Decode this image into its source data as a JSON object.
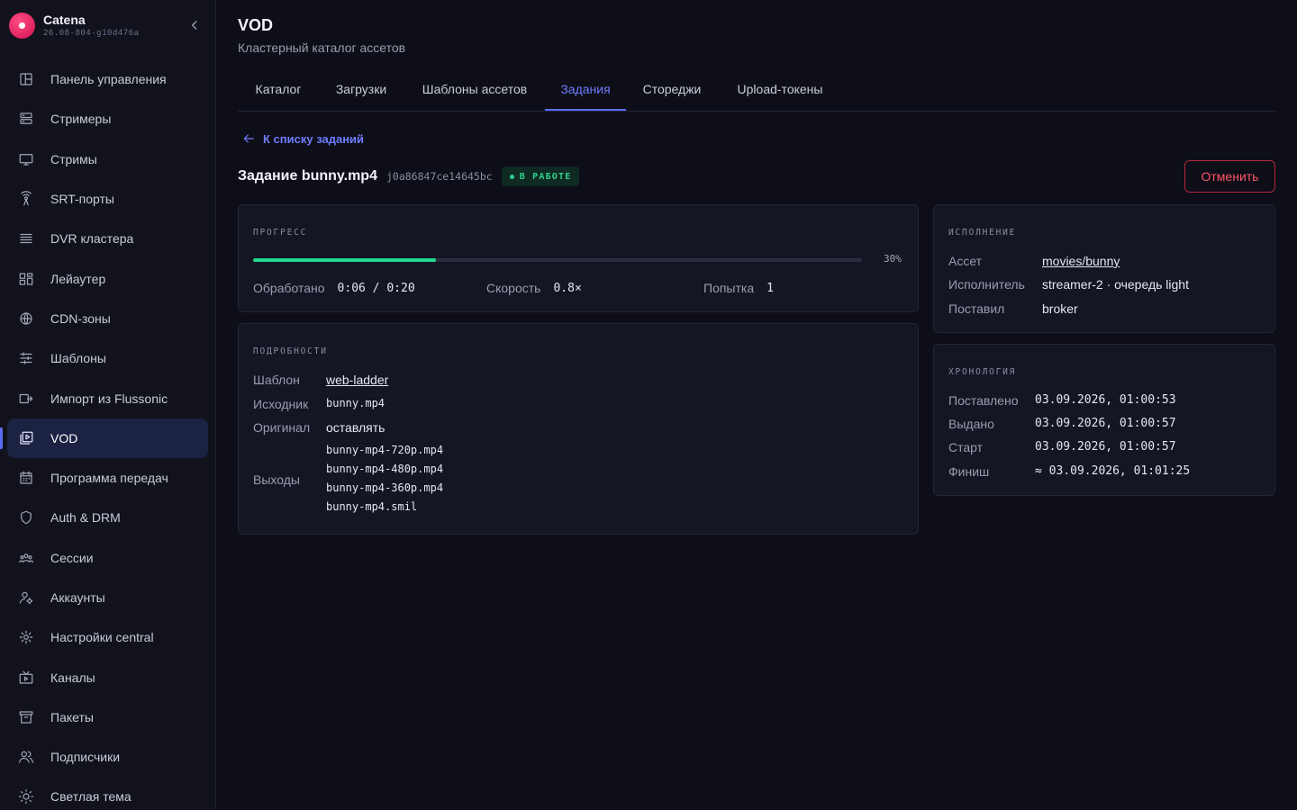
{
  "app": {
    "name": "Catena",
    "version": "26.08-804-g10d476a"
  },
  "sidebar": {
    "items": [
      {
        "label": "Панель управления",
        "icon": "dashboard-icon"
      },
      {
        "label": "Стримеры",
        "icon": "server-icon"
      },
      {
        "label": "Стримы",
        "icon": "monitor-icon"
      },
      {
        "label": "SRT-порты",
        "icon": "broadcast-icon"
      },
      {
        "label": "DVR кластера",
        "icon": "storage-icon"
      },
      {
        "label": "Лейаутер",
        "icon": "layout-icon"
      },
      {
        "label": "CDN-зоны",
        "icon": "globe-icon"
      },
      {
        "label": "Шаблоны",
        "icon": "sliders-icon"
      },
      {
        "label": "Импорт из Flussonic",
        "icon": "import-icon"
      },
      {
        "label": "VOD",
        "icon": "video-library-icon",
        "active": true
      },
      {
        "label": "Программа передач",
        "icon": "calendar-icon"
      },
      {
        "label": "Auth & DRM",
        "icon": "shield-icon"
      },
      {
        "label": "Сессии",
        "icon": "users-group-icon"
      },
      {
        "label": "Аккаунты",
        "icon": "user-settings-icon"
      },
      {
        "label": "Настройки central",
        "icon": "gear-icon"
      },
      {
        "label": "Каналы",
        "icon": "tv-icon"
      },
      {
        "label": "Пакеты",
        "icon": "archive-icon"
      },
      {
        "label": "Подписчики",
        "icon": "subscribers-icon"
      },
      {
        "label": "Светлая тема",
        "icon": "sun-icon"
      }
    ]
  },
  "header": {
    "title": "VOD",
    "subtitle": "Кластерный каталог ассетов"
  },
  "tabs": [
    {
      "label": "Каталог"
    },
    {
      "label": "Загрузки"
    },
    {
      "label": "Шаблоны ассетов"
    },
    {
      "label": "Задания",
      "active": true
    },
    {
      "label": "Стореджи"
    },
    {
      "label": "Upload-токены"
    }
  ],
  "back_link": "К списку заданий",
  "job": {
    "title_prefix": "Задание",
    "name": "bunny.mp4",
    "id": "j0a86847ce14645bc",
    "status": "В РАБОТЕ",
    "cancel_label": "Отменить"
  },
  "progress": {
    "label": "ПРОГРЕСС",
    "fraction": 0.3,
    "percent_text": "30%",
    "processed_label": "Обработано",
    "processed_value": "0:06 / 0:20",
    "speed_label": "Скорость",
    "speed_value": "0.8×",
    "attempt_label": "Попытка",
    "attempt_value": "1"
  },
  "details": {
    "label": "ПОДРОБНОСТИ",
    "template_label": "Шаблон",
    "template_value": "web-ladder",
    "source_label": "Исходник",
    "source_value": "bunny.mp4",
    "original_label": "Оригинал",
    "original_value": "оставлять",
    "outputs_label": "Выходы",
    "outputs": [
      "bunny-mp4-720p.mp4",
      "bunny-mp4-480p.mp4",
      "bunny-mp4-360p.mp4",
      "bunny-mp4.smil"
    ]
  },
  "execution": {
    "label": "ИСПОЛНЕНИЕ",
    "asset_label": "Ассет",
    "asset_value": "movies/bunny",
    "executor_label": "Исполнитель",
    "executor_value": "streamer-2 · очередь light",
    "submitted_by_label": "Поставил",
    "submitted_by_value": "broker"
  },
  "timeline": {
    "label": "ХРОНОЛОГИЯ",
    "rows": [
      {
        "label": "Поставлено",
        "value": "03.09.2026, 01:00:53"
      },
      {
        "label": "Выдано",
        "value": "03.09.2026, 01:00:57"
      },
      {
        "label": "Старт",
        "value": "03.09.2026, 01:00:57"
      },
      {
        "label": "Финиш",
        "value": "≈ 03.09.2026, 01:01:25"
      }
    ]
  },
  "colors": {
    "accent": "#5b6bff",
    "success": "#20d990",
    "danger": "#ff5466",
    "background": "#0d0e17"
  }
}
